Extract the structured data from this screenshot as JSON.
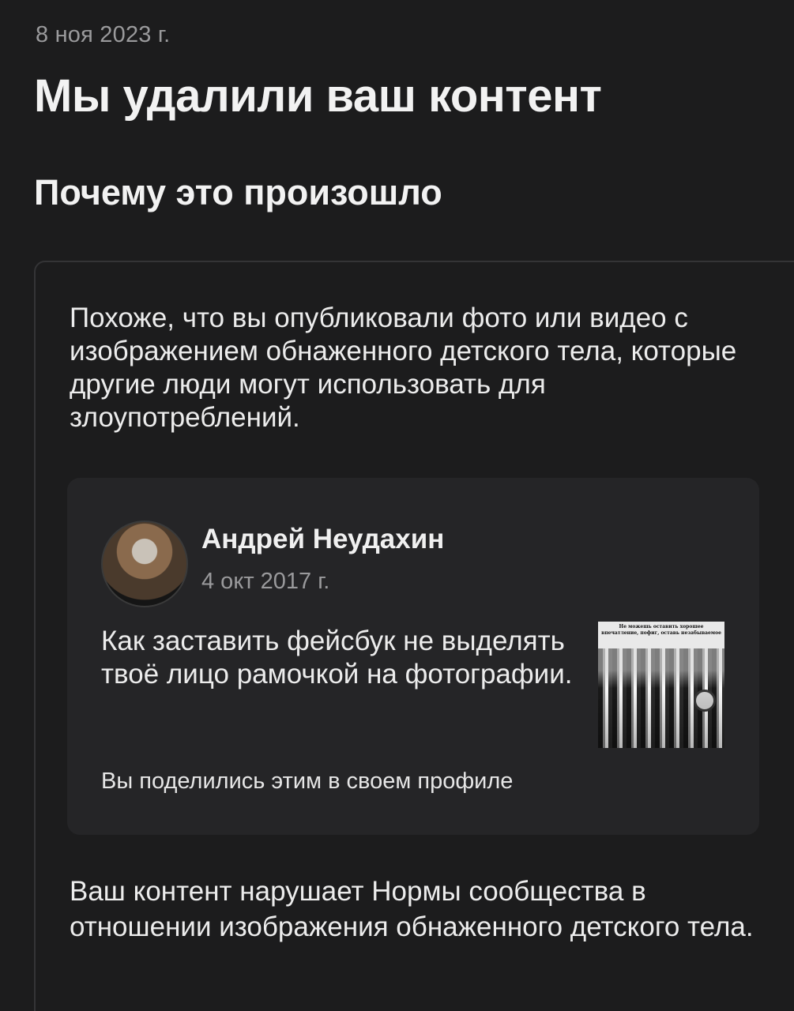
{
  "header": {
    "date": "8 ноя 2023 г.",
    "title": "Мы удалили ваш контент",
    "subtitle": "Почему это произошло"
  },
  "card": {
    "reason_text": "Похоже, что вы опубликовали фото или видео с изображением обнаженного детского тела, которые другие люди могут использовать для злоупотреблений.",
    "post": {
      "author": "Андрей Неудахин",
      "date": "4 окт 2017 г.",
      "text": "Как заставить фейсбук не выделять твоё лицо рамочкой на фотографии.",
      "thumbnail_caption": "Не можешь оставить хорошее впечатление, пофиг, оставь незабываемое",
      "shared_note": "Вы поделились этим в своем профиле"
    },
    "violation_text": "Ваш контент нарушает Нормы сообщества в отношении изображения обнаженного детского тела."
  }
}
